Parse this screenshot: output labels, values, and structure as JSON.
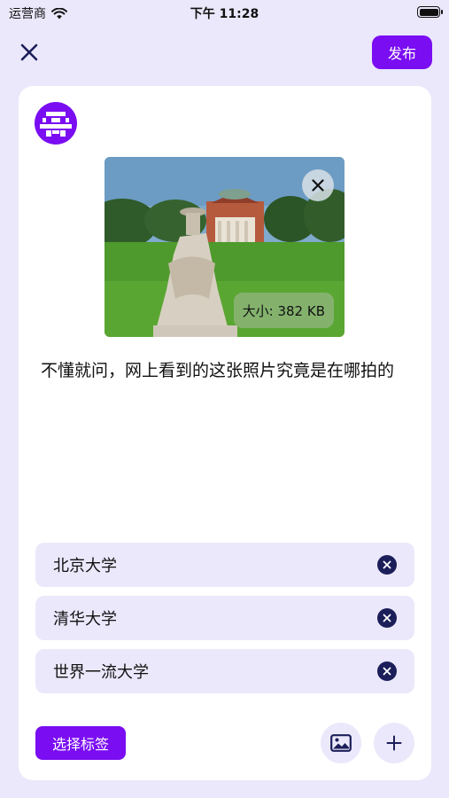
{
  "status_bar": {
    "carrier": "运营商",
    "time": "下午 11:28"
  },
  "header": {
    "close_icon": "close-icon",
    "publish_label": "发布",
    "accent_color": "#7a0df2"
  },
  "post": {
    "avatar_icon": "pixel-avatar-icon",
    "photo": {
      "size_label": "大小: 382 KB",
      "remove_icon": "close-icon"
    },
    "text": "不懂就问，网上看到的这张照片究竟是在哪拍的"
  },
  "tags": [
    {
      "label": "北京大学"
    },
    {
      "label": "清华大学"
    },
    {
      "label": "世界一流大学"
    }
  ],
  "footer": {
    "select_tag_label": "选择标签",
    "image_icon": "image-icon",
    "add_icon": "plus-icon"
  }
}
